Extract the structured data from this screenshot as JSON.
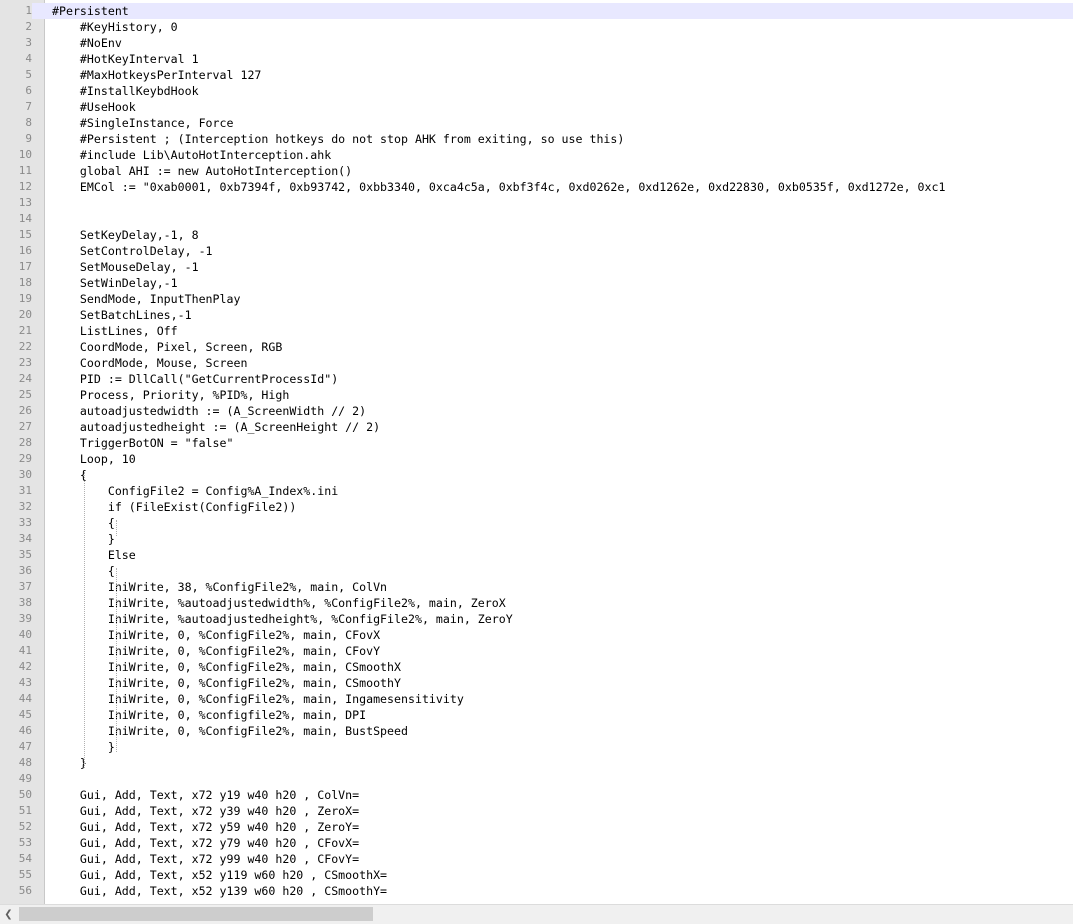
{
  "editor": {
    "lines": [
      {
        "n": "1",
        "text": "#Persistent"
      },
      {
        "n": "2",
        "text": "    #KeyHistory, 0"
      },
      {
        "n": "3",
        "text": "    #NoEnv"
      },
      {
        "n": "4",
        "text": "    #HotKeyInterval 1"
      },
      {
        "n": "5",
        "text": "    #MaxHotkeysPerInterval 127"
      },
      {
        "n": "6",
        "text": "    #InstallKeybdHook"
      },
      {
        "n": "7",
        "text": "    #UseHook"
      },
      {
        "n": "8",
        "text": "    #SingleInstance, Force"
      },
      {
        "n": "9",
        "text": "    #Persistent ; (Interception hotkeys do not stop AHK from exiting, so use this)"
      },
      {
        "n": "10",
        "text": "    #include Lib\\AutoHotInterception.ahk"
      },
      {
        "n": "11",
        "text": "    global AHI := new AutoHotInterception()"
      },
      {
        "n": "12",
        "text": "    EMCol := \"0xab0001, 0xb7394f, 0xb93742, 0xbb3340, 0xca4c5a, 0xbf3f4c, 0xd0262e, 0xd1262e, 0xd22830, 0xb0535f, 0xd1272e, 0xc1"
      },
      {
        "n": "13",
        "text": ""
      },
      {
        "n": "14",
        "text": ""
      },
      {
        "n": "15",
        "text": "    SetKeyDelay,-1, 8"
      },
      {
        "n": "16",
        "text": "    SetControlDelay, -1"
      },
      {
        "n": "17",
        "text": "    SetMouseDelay, -1"
      },
      {
        "n": "18",
        "text": "    SetWinDelay,-1"
      },
      {
        "n": "19",
        "text": "    SendMode, InputThenPlay"
      },
      {
        "n": "20",
        "text": "    SetBatchLines,-1"
      },
      {
        "n": "21",
        "text": "    ListLines, Off"
      },
      {
        "n": "22",
        "text": "    CoordMode, Pixel, Screen, RGB"
      },
      {
        "n": "23",
        "text": "    CoordMode, Mouse, Screen"
      },
      {
        "n": "24",
        "text": "    PID := DllCall(\"GetCurrentProcessId\")"
      },
      {
        "n": "25",
        "text": "    Process, Priority, %PID%, High"
      },
      {
        "n": "26",
        "text": "    autoadjustedwidth := (A_ScreenWidth // 2)"
      },
      {
        "n": "27",
        "text": "    autoadjustedheight := (A_ScreenHeight // 2)"
      },
      {
        "n": "28",
        "text": "    TriggerBotON = \"false\""
      },
      {
        "n": "29",
        "text": "    Loop, 10"
      },
      {
        "n": "30",
        "text": "    {"
      },
      {
        "n": "31",
        "text": "        ConfigFile2 = Config%A_Index%.ini"
      },
      {
        "n": "32",
        "text": "        if (FileExist(ConfigFile2))"
      },
      {
        "n": "33",
        "text": "        {"
      },
      {
        "n": "34",
        "text": "        }"
      },
      {
        "n": "35",
        "text": "        Else"
      },
      {
        "n": "36",
        "text": "        {"
      },
      {
        "n": "37",
        "text": "        IniWrite, 38, %ConfigFile2%, main, ColVn"
      },
      {
        "n": "38",
        "text": "        IniWrite, %autoadjustedwidth%, %ConfigFile2%, main, ZeroX"
      },
      {
        "n": "39",
        "text": "        IniWrite, %autoadjustedheight%, %ConfigFile2%, main, ZeroY"
      },
      {
        "n": "40",
        "text": "        IniWrite, 0, %ConfigFile2%, main, CFovX"
      },
      {
        "n": "41",
        "text": "        IniWrite, 0, %ConfigFile2%, main, CFovY"
      },
      {
        "n": "42",
        "text": "        IniWrite, 0, %ConfigFile2%, main, CSmoothX"
      },
      {
        "n": "43",
        "text": "        IniWrite, 0, %ConfigFile2%, main, CSmoothY"
      },
      {
        "n": "44",
        "text": "        IniWrite, 0, %ConfigFile2%, main, Ingamesensitivity"
      },
      {
        "n": "45",
        "text": "        IniWrite, 0, %configfile2%, main, DPI"
      },
      {
        "n": "46",
        "text": "        IniWrite, 0, %ConfigFile2%, main, BustSpeed"
      },
      {
        "n": "47",
        "text": "        }"
      },
      {
        "n": "48",
        "text": "    }"
      },
      {
        "n": "49",
        "text": ""
      },
      {
        "n": "50",
        "text": "    Gui, Add, Text, x72 y19 w40 h20 , ColVn="
      },
      {
        "n": "51",
        "text": "    Gui, Add, Text, x72 y39 w40 h20 , ZeroX="
      },
      {
        "n": "52",
        "text": "    Gui, Add, Text, x72 y59 w40 h20 , ZeroY="
      },
      {
        "n": "53",
        "text": "    Gui, Add, Text, x72 y79 w40 h20 , CFovX="
      },
      {
        "n": "54",
        "text": "    Gui, Add, Text, x72 y99 w40 h20 , CFovY="
      },
      {
        "n": "55",
        "text": "    Gui, Add, Text, x52 y119 w60 h20 , CSmoothX="
      },
      {
        "n": "56",
        "text": "    Gui, Add, Text, x52 y139 w60 h20 , CSmoothY="
      }
    ]
  },
  "scrollbar": {
    "left_arrow_icon": "chevron-left-icon"
  }
}
